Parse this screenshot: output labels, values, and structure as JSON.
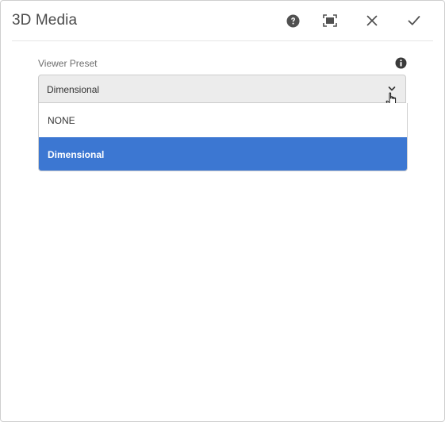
{
  "dialog": {
    "title": "3D Media",
    "actions": {
      "help": "help-icon",
      "fullscreen": "fullscreen-icon",
      "close": "close-icon",
      "done": "checkmark-icon"
    }
  },
  "field": {
    "label": "Viewer Preset",
    "info_icon": "info-icon",
    "selected_value": "Dimensional",
    "options": [
      {
        "label": "NONE",
        "selected": false
      },
      {
        "label": "Dimensional",
        "selected": true
      }
    ]
  },
  "colors": {
    "selected_option_bg": "#3c77d2",
    "select_bg": "#ececec",
    "text": "#4b4b4b"
  }
}
